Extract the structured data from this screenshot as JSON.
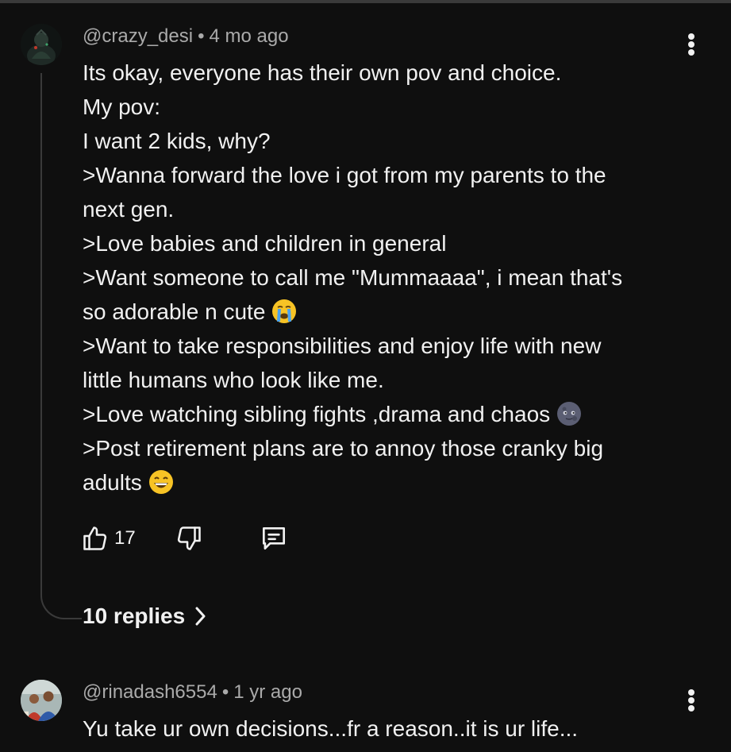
{
  "comments": [
    {
      "author": "@crazy_desi",
      "separator": "•",
      "time": "4 mo ago",
      "lines": [
        "Its okay, everyone has their own pov and choice.",
        "My pov:",
        "I want 2 kids, why?",
        ">Wanna forward the love i got from my parents to the",
        "next gen.",
        ">Love babies and children in general",
        ">Want someone to call me \"Mummaaaa\", i mean that's",
        "so adorable n cute",
        ">Want to take responsibilities and enjoy life with new",
        "little humans who look like me.",
        ">Love watching sibling fights ,drama and chaos",
        ">Post retirement plans are to annoy those cranky big",
        "adults"
      ],
      "emojis": {
        "line_7": "loudly-crying-face-emoji",
        "line_10": "new-moon-face-emoji",
        "line_12": "grinning-face-emoji"
      },
      "like_count": "17",
      "replies_label": "10 replies",
      "icons": {
        "like": "thumbs-up-icon",
        "dislike": "thumbs-down-icon",
        "reply": "comment-icon",
        "more": "more-vertical-icon",
        "expand": "chevron-right-icon"
      }
    },
    {
      "author": "@rinadash6554",
      "separator": "•",
      "time": "1 yr ago",
      "text": "Yu take ur own decisions...fr a reason..it is ur life..."
    }
  ],
  "colors": {
    "background": "#0f0f0f",
    "text_primary": "#f1f1f1",
    "text_secondary": "#aaaaaa",
    "divider": "#3a3a3a"
  }
}
